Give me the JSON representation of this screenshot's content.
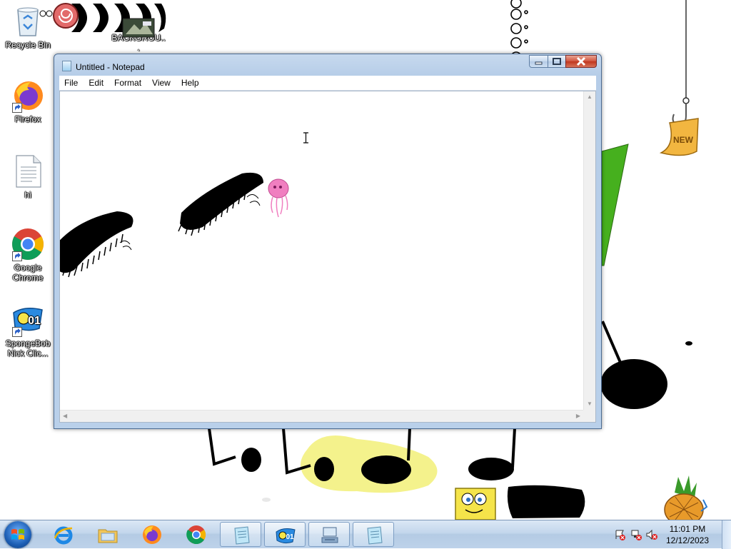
{
  "desktop": {
    "icons": [
      {
        "label": "Recycle Bin",
        "icon": "recycle-bin-icon"
      },
      {
        "label": "BACKGROU...",
        "icon": "image-file-icon"
      },
      {
        "label": "Firefox",
        "icon": "firefox-icon"
      },
      {
        "label": "hi",
        "icon": "text-file-icon"
      },
      {
        "label": "Google Chrome",
        "icon": "chrome-icon"
      },
      {
        "label": "SpongeBob Nick Clic...",
        "icon": "spongebob-game-icon"
      }
    ],
    "wallpaper": {
      "sticker_text": "NEW"
    }
  },
  "window": {
    "title": "Untitled - Notepad",
    "menu": [
      "File",
      "Edit",
      "Format",
      "View",
      "Help"
    ],
    "content": "",
    "buttons": [
      "minimize",
      "maximize",
      "close"
    ]
  },
  "taskbar": {
    "pinned": [
      "internet-explorer-icon",
      "windows-explorer-icon",
      "firefox-icon",
      "chrome-icon",
      "notepad-icon",
      "spongebob-game-icon",
      "network-program-icon",
      "notepad-icon"
    ],
    "tray_icons": [
      "action-center-alert-icon",
      "network-alert-icon",
      "volume-muted-icon"
    ],
    "clock": {
      "time": "11:01 PM",
      "date": "12/12/2023"
    }
  },
  "colors": {
    "taskbar": "#c3d6ec",
    "title_bar": "#b6cde8",
    "close_button": "#c0361e",
    "wall_green": "#46b01e",
    "jellyfish_pink": "#f07fc0",
    "yellow_splash": "#f4f28c"
  }
}
